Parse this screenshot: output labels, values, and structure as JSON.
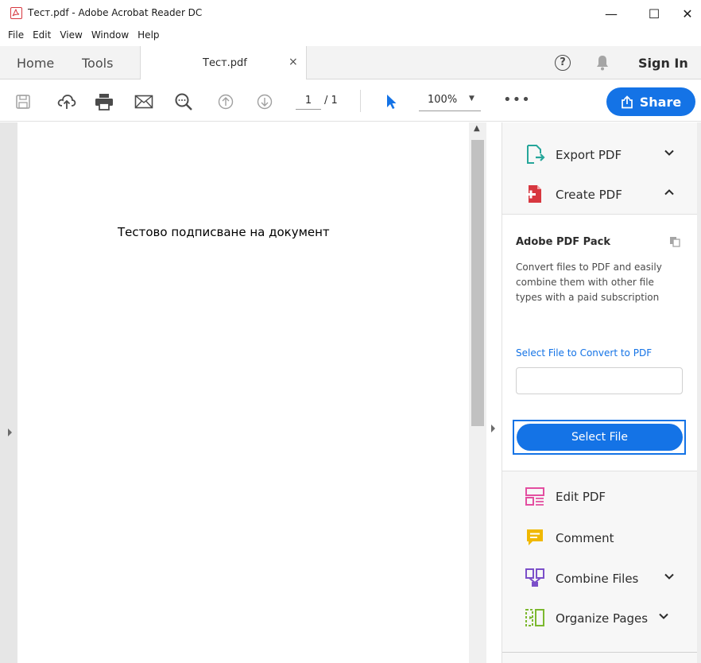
{
  "window": {
    "title": "Тест.pdf - Adobe Acrobat Reader DC",
    "minimize": "—",
    "maximize": "☐",
    "close": "✕"
  },
  "menu": [
    "File",
    "Edit",
    "View",
    "Window",
    "Help"
  ],
  "tabs": {
    "home": "Home",
    "tools": "Tools",
    "document": "Тест.pdf",
    "close": "×"
  },
  "header_right": {
    "help": "?",
    "sign_in": "Sign In"
  },
  "toolbar": {
    "page_current": "1",
    "page_total": "/ 1",
    "zoom": "100%",
    "more": "•••",
    "share": "Share"
  },
  "document": {
    "text": "Тестово подписване на документ"
  },
  "right_panel": {
    "export_pdf": "Export PDF",
    "create_pdf": "Create PDF",
    "pack": {
      "title": "Adobe PDF Pack",
      "description": "Convert files to PDF and easily combine them with other file types with a paid subscription",
      "link": "Select File to Convert to PDF",
      "button": "Select File"
    },
    "edit_pdf": "Edit PDF",
    "comment": "Comment",
    "combine_files": "Combine Files",
    "organize_pages": "Organize Pages"
  },
  "colors": {
    "accent": "#1473e6",
    "export": "#26a69a",
    "create": "#d7373f",
    "edit": "#e34ea0",
    "comment": "#f0b800",
    "combine": "#7b4fc9",
    "organize": "#7cb82f"
  },
  "icons": [
    "save-icon",
    "upload-icon",
    "print-icon",
    "mail-icon",
    "zoom-search-icon",
    "page-up-icon",
    "page-down-icon",
    "select-arrow-icon",
    "share-icon",
    "bell-icon",
    "help-icon"
  ]
}
